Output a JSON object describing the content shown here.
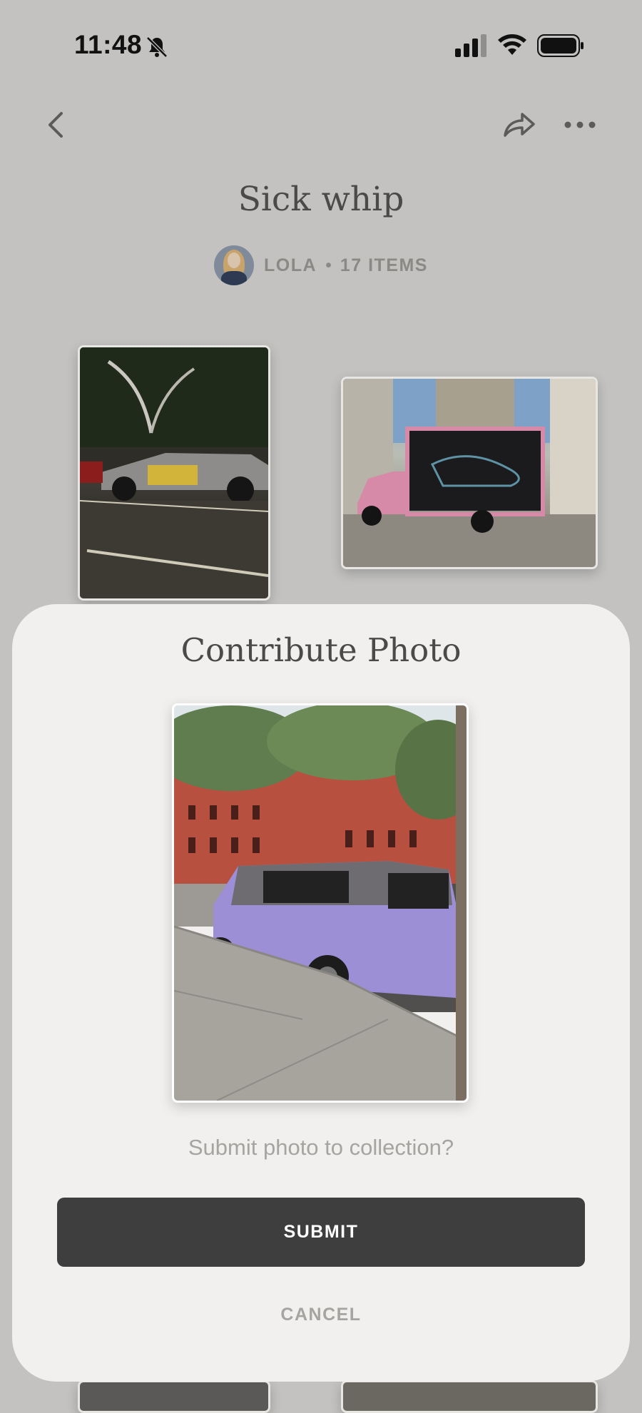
{
  "status_bar": {
    "time": "11:48",
    "icons": [
      "bell-slash-icon",
      "signal-icon",
      "wifi-icon",
      "battery-icon"
    ]
  },
  "nav": {
    "back_icon": "chevron-left-icon",
    "share_icon": "share-arrow-icon",
    "more_icon": "ellipsis-icon"
  },
  "collection": {
    "title": "Sick whip",
    "owner": "LOLA",
    "separator": "•",
    "item_count": "17 ITEMS"
  },
  "dialog": {
    "title": "Contribute Photo",
    "question": "Submit photo to collection?",
    "submit_label": "SUBMIT",
    "cancel_label": "CANCEL"
  },
  "colors": {
    "background": "#c3c2c0",
    "sheet": "#f2f0ee",
    "submit_button": "#3e3e3e",
    "muted_text": "#a6a4a1"
  }
}
